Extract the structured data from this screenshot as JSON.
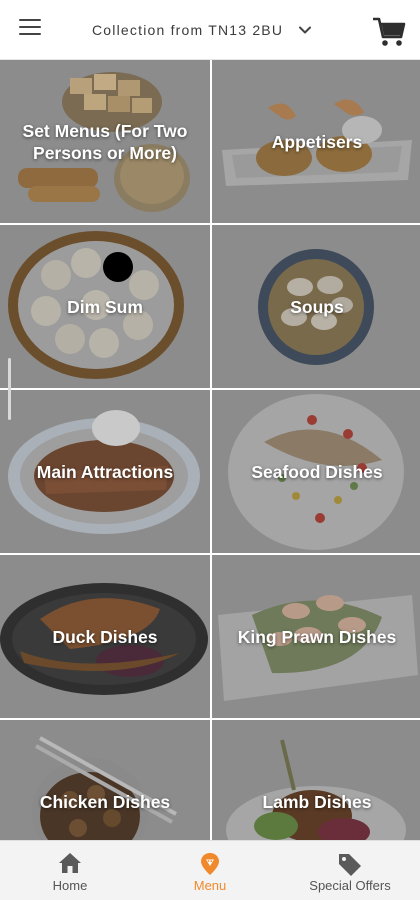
{
  "header": {
    "collection_label": "Collection from TN13 2BU",
    "icons": {
      "menu": "hamburger-icon",
      "dropdown": "chevron-down-icon",
      "cart": "cart-icon"
    }
  },
  "colors": {
    "accent": "#f0892c",
    "overlay": "#8e8e8e",
    "text_on_tile": "#ffffff"
  },
  "categories": [
    {
      "label": "Set Menus (For Two Persons or More)"
    },
    {
      "label": "Appetisers"
    },
    {
      "label": "Dim Sum"
    },
    {
      "label": "Soups"
    },
    {
      "label": "Main Attractions"
    },
    {
      "label": "Seafood Dishes"
    },
    {
      "label": "Duck Dishes"
    },
    {
      "label": "King Prawn Dishes"
    },
    {
      "label": "Chicken Dishes"
    },
    {
      "label": "Lamb Dishes"
    }
  ],
  "bottom_nav": {
    "items": [
      {
        "label": "Home",
        "icon": "home-icon",
        "active": false
      },
      {
        "label": "Menu",
        "icon": "menu-pin-icon",
        "active": true
      },
      {
        "label": "Special Offers",
        "icon": "tag-icon",
        "active": false
      }
    ]
  }
}
